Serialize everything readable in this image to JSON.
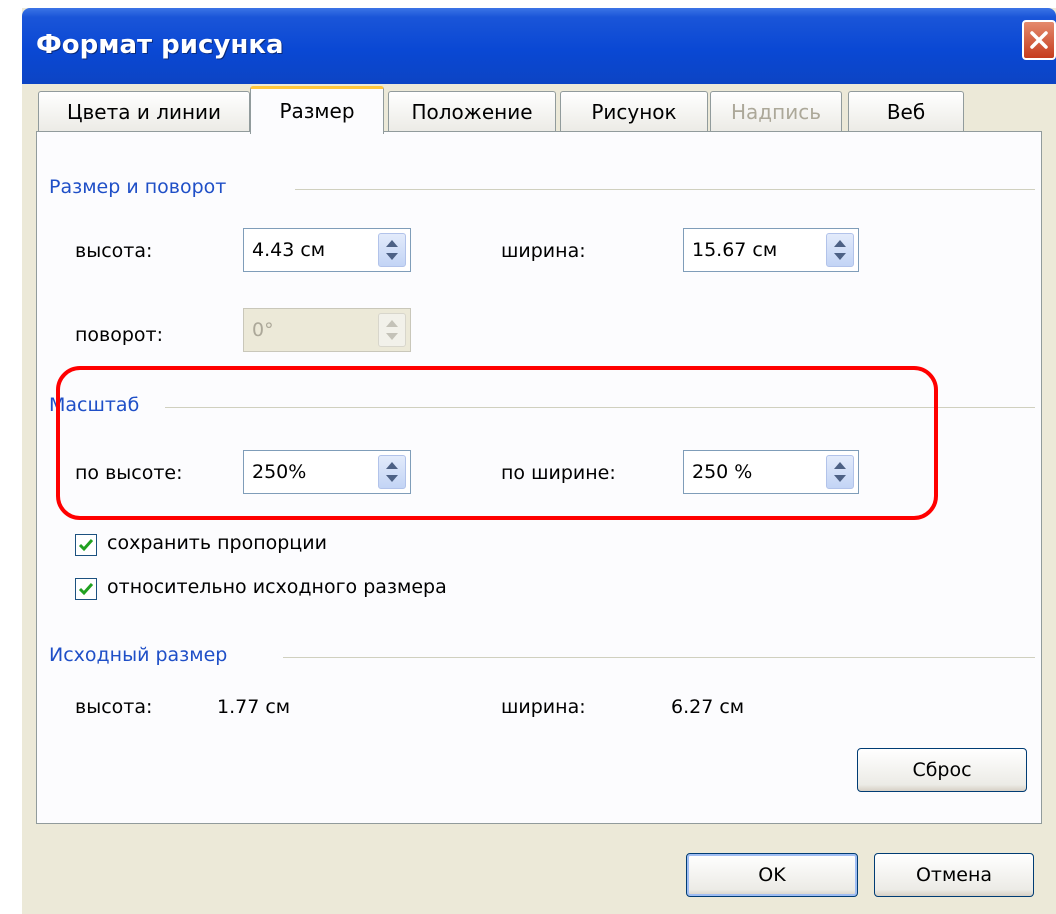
{
  "window": {
    "title": "Формат рисунка"
  },
  "tabs": [
    {
      "label": "Цвета и линии",
      "state": "normal"
    },
    {
      "label": "Размер",
      "state": "active"
    },
    {
      "label": "Положение",
      "state": "normal"
    },
    {
      "label": "Рисунок",
      "state": "normal"
    },
    {
      "label": "Надпись",
      "state": "disabled"
    },
    {
      "label": "Веб",
      "state": "normal"
    }
  ],
  "size_rotate": {
    "title": "Размер и поворот",
    "height_label": "высота:",
    "height_value": "4.43 см",
    "width_label": "ширина:",
    "width_value": "15.67 см",
    "rotation_label": "поворот:",
    "rotation_value": "0°"
  },
  "scale": {
    "title": "Масштаб",
    "height_label": "по высоте:",
    "height_value": "250%",
    "width_label": "по ширине:",
    "width_value": "250 %",
    "lock_aspect_label": "сохранить пропорции",
    "lock_aspect_checked": true,
    "relative_original_label": "относительно исходного размера",
    "relative_original_checked": true
  },
  "original_size": {
    "title": "Исходный размер",
    "height_label": "высота:",
    "height_value": "1.77 см",
    "width_label": "ширина:",
    "width_value": "6.27 см",
    "reset_label": "Сброс"
  },
  "footer": {
    "ok_label": "OK",
    "cancel_label": "Отмена"
  },
  "colors": {
    "titlebar": "#0a48d4",
    "dialog_bg": "#ece9d8",
    "group_title": "#1f4fc7",
    "highlight": "#ff0000",
    "active_tab_accent": "#ffc73c"
  }
}
